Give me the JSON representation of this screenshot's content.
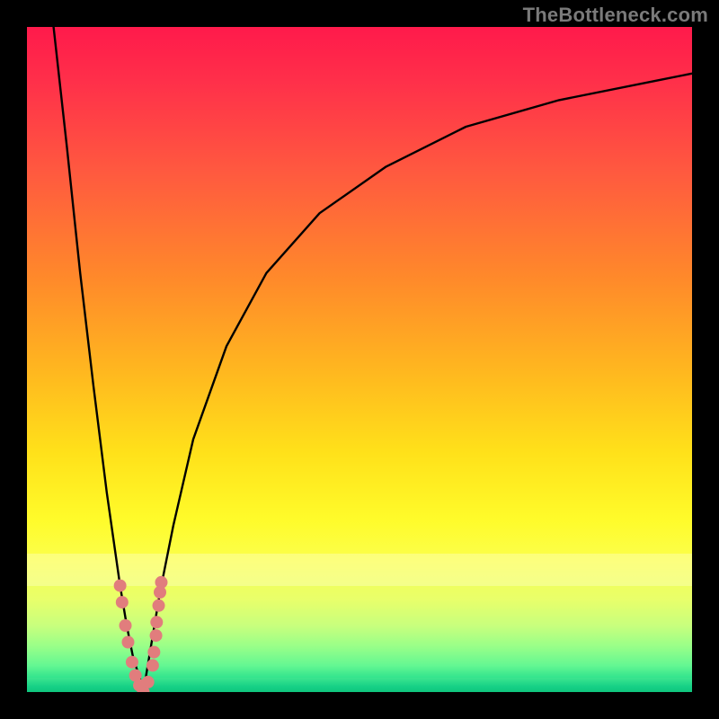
{
  "watermark": "TheBottleneck.com",
  "chart_data": {
    "type": "line",
    "title": "",
    "xlabel": "",
    "ylabel": "",
    "xlim": [
      0,
      100
    ],
    "ylim": [
      0,
      100
    ],
    "grid": false,
    "legend": false,
    "background": "gradient red→yellow→green (top→bottom)",
    "series": [
      {
        "name": "left-branch",
        "x": [
          4,
          6,
          8,
          10,
          12,
          14,
          15,
          16,
          17,
          17.5
        ],
        "y": [
          100,
          82,
          63,
          46,
          30,
          16,
          10,
          5,
          2,
          0
        ]
      },
      {
        "name": "right-branch",
        "x": [
          17.5,
          18,
          19,
          20,
          22,
          25,
          30,
          36,
          44,
          54,
          66,
          80,
          95,
          100
        ],
        "y": [
          0,
          3,
          9,
          15,
          25,
          38,
          52,
          63,
          72,
          79,
          85,
          89,
          92,
          93
        ]
      }
    ],
    "dots": {
      "name": "highlighted-points",
      "color": "#e17d7d",
      "points": [
        {
          "x": 14.0,
          "y": 16.0
        },
        {
          "x": 14.3,
          "y": 13.5
        },
        {
          "x": 14.8,
          "y": 10.0
        },
        {
          "x": 15.2,
          "y": 7.5
        },
        {
          "x": 15.8,
          "y": 4.5
        },
        {
          "x": 16.3,
          "y": 2.5
        },
        {
          "x": 16.9,
          "y": 1.0
        },
        {
          "x": 17.5,
          "y": 0.0
        },
        {
          "x": 18.2,
          "y": 1.5
        },
        {
          "x": 18.9,
          "y": 4.0
        },
        {
          "x": 19.1,
          "y": 6.0
        },
        {
          "x": 19.4,
          "y": 8.5
        },
        {
          "x": 19.5,
          "y": 10.5
        },
        {
          "x": 19.8,
          "y": 13.0
        },
        {
          "x": 20.0,
          "y": 15.0
        },
        {
          "x": 20.2,
          "y": 16.5
        }
      ]
    }
  }
}
